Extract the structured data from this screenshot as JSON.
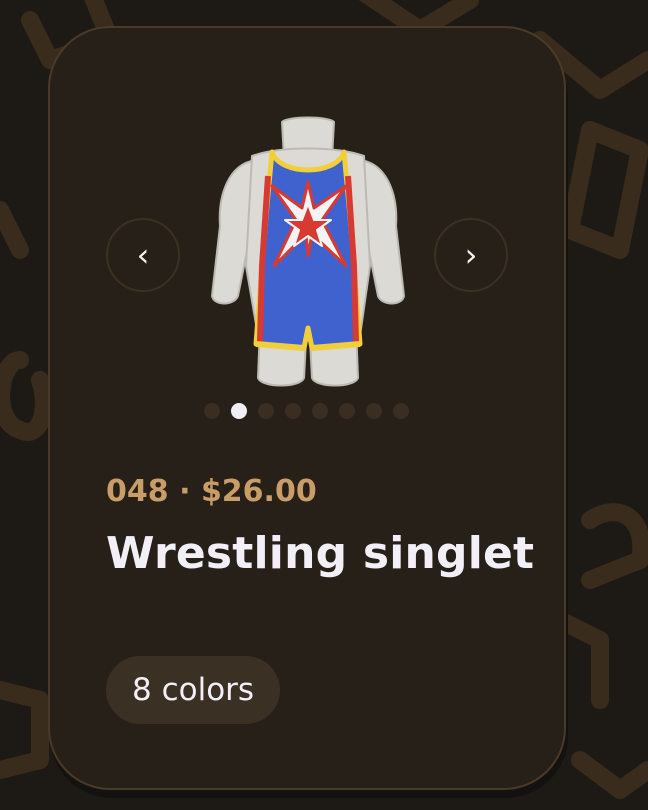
{
  "item": {
    "number": "048",
    "separator": "·",
    "price": "$26.00",
    "name": "Wrestling singlet",
    "colors_label": "8 colors"
  },
  "carousel": {
    "prev_label": "‹",
    "next_label": "›",
    "dot_count": 8,
    "active_index": 1
  },
  "colors": {
    "background": "#1d1a16",
    "card": "#272019",
    "accent": "#c89d68",
    "text": "#f2f0f6",
    "singlet_blue": "#3f62cf",
    "singlet_red": "#d63a32",
    "singlet_yellow": "#f1cf3a"
  },
  "icons": {
    "prev": "chevron-left-icon",
    "next": "chevron-right-icon"
  }
}
